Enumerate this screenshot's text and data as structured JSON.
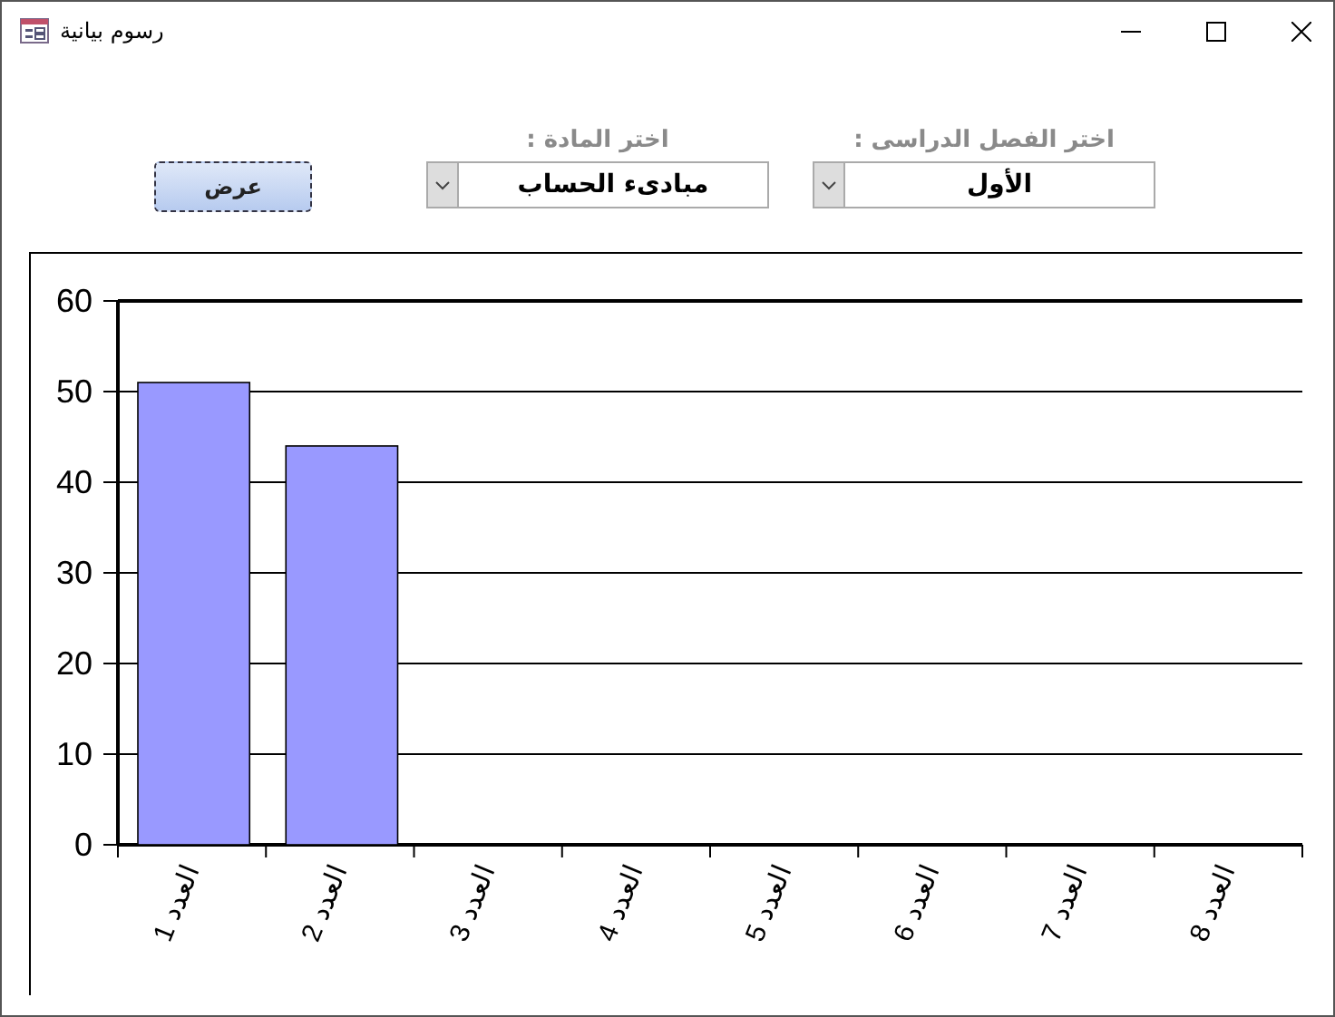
{
  "window": {
    "title": "رسوم بيانية"
  },
  "filters": [
    {
      "label": "اختر الفصل الدراسى :",
      "value": "الأول"
    },
    {
      "label": "اختر المادة :",
      "value": "مبادىء الحساب"
    }
  ],
  "show_button": "عرض",
  "chart": {
    "chart_data": {
      "type": "bar",
      "categories": [
        "العدد 1",
        "العدد 2",
        "العدد 3",
        "العدد 4",
        "العدد 5",
        "العدد 6",
        "العدد 7",
        "العدد 8"
      ],
      "series": [
        {
          "color": "#9999ff",
          "values": [
            51,
            44,
            0,
            0,
            0,
            0,
            0,
            0
          ]
        }
      ],
      "ylim": [
        0,
        60
      ],
      "grid": true,
      "yticks": [
        0,
        10,
        20,
        30,
        40,
        50,
        60
      ]
    }
  }
}
